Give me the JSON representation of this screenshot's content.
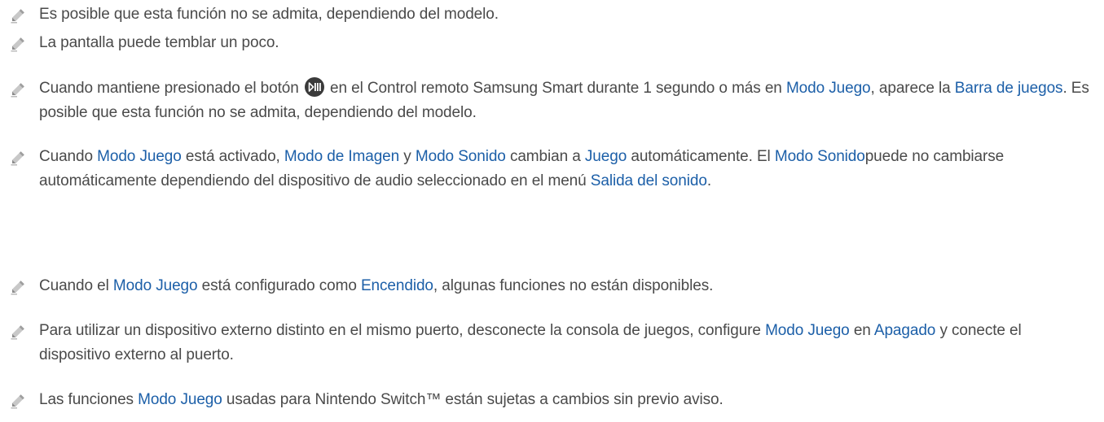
{
  "notes": [
    {
      "segments": [
        {
          "text": "Es posible que esta función no se admita, dependiendo del modelo.",
          "hl": false
        }
      ]
    },
    {
      "segments": [
        {
          "text": "La pantalla puede temblar un poco.",
          "hl": false
        }
      ]
    },
    {
      "segments": [
        {
          "text": "Cuando mantiene presionado el botón ",
          "hl": false
        },
        {
          "icon": "play-pause-button-icon"
        },
        {
          "text": " en el Control remoto Samsung Smart durante 1 segundo o más en ",
          "hl": false
        },
        {
          "text": "Modo Juego",
          "hl": true
        },
        {
          "text": ", aparece la ",
          "hl": false
        },
        {
          "text": "Barra de juegos",
          "hl": true
        },
        {
          "text": ". Es posible que esta función no se admita, dependiendo del modelo.",
          "hl": false
        }
      ]
    },
    {
      "segments": [
        {
          "text": "Cuando ",
          "hl": false
        },
        {
          "text": "Modo Juego",
          "hl": true
        },
        {
          "text": " está activado, ",
          "hl": false
        },
        {
          "text": "Modo de Imagen",
          "hl": true
        },
        {
          "text": " y ",
          "hl": false
        },
        {
          "text": "Modo Sonido",
          "hl": true
        },
        {
          "text": " cambian a ",
          "hl": false
        },
        {
          "text": "Juego",
          "hl": true
        },
        {
          "text": " automáticamente. El ",
          "hl": false
        },
        {
          "text": "Modo Sonido",
          "hl": true
        },
        {
          "text": "puede no cambiarse automáticamente dependiendo del dispositivo de audio seleccionado en el menú ",
          "hl": false
        },
        {
          "text": "Salida del sonido",
          "hl": true
        },
        {
          "text": ".",
          "hl": false
        }
      ]
    },
    {
      "segments": [
        {
          "text": "Cuando el ",
          "hl": false
        },
        {
          "text": "Modo Juego",
          "hl": true
        },
        {
          "text": " está configurado como ",
          "hl": false
        },
        {
          "text": "Encendido",
          "hl": true
        },
        {
          "text": ", algunas funciones no están disponibles.",
          "hl": false
        }
      ]
    },
    {
      "segments": [
        {
          "text": "Para utilizar un dispositivo externo distinto en el mismo puerto, desconecte la consola de juegos, configure ",
          "hl": false
        },
        {
          "text": "Modo Juego",
          "hl": true
        },
        {
          "text": " en ",
          "hl": false
        },
        {
          "text": "Apagado",
          "hl": true
        },
        {
          "text": " y conecte el dispositivo externo al puerto.",
          "hl": false
        }
      ]
    },
    {
      "segments": [
        {
          "text": "Las funciones ",
          "hl": false
        },
        {
          "text": "Modo Juego",
          "hl": true
        },
        {
          "text": " usadas para Nintendo Switch™ están sujetas a cambios sin previo aviso.",
          "hl": false
        }
      ]
    }
  ],
  "icons": {
    "note": "pencil-note-icon",
    "remote_button": "play-pause-button-icon"
  },
  "colors": {
    "text": "#4a4a4a",
    "highlight": "#1c5fa8",
    "icon": "#b5b5b5"
  }
}
